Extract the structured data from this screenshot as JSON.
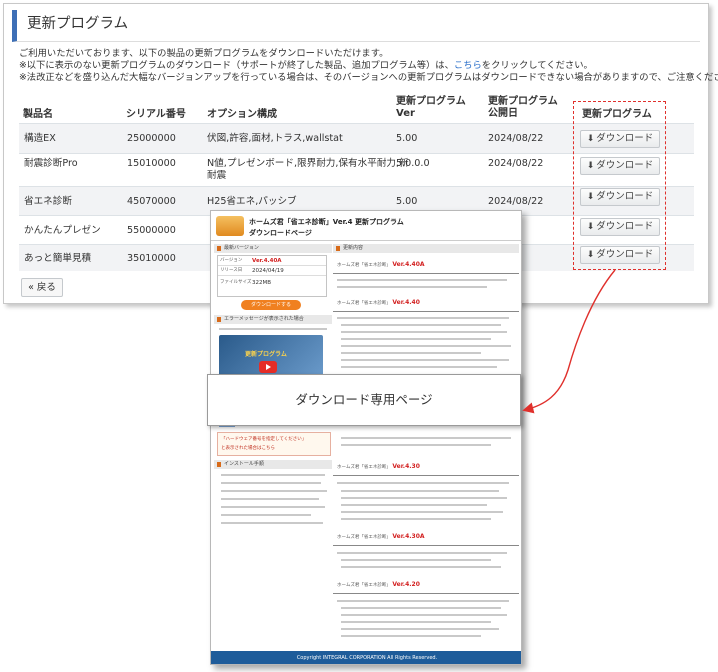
{
  "panel": {
    "title": "更新プログラム",
    "notice1": "ご利用いただいております、以下の製品の更新プログラムをダウンロードいただけます。",
    "notice2_before": "※以下に表示のない更新プログラムのダウンロード（サポートが終了した製品、追加プログラム等）は、",
    "notice2_link": "こちら",
    "notice2_after": "をクリックしてください。",
    "notice3": "※法改正などを盛り込んだ大幅なバージョンアップを行っている場合は、そのバージョンへの更新プログラムはダウンロードできない場合がありますので、ご注意ください。",
    "columns": {
      "product": "製品名",
      "serial": "シリアル番号",
      "option": "オプション構成",
      "ver_1": "更新プログラム",
      "ver_2": "Ver",
      "date_1": "更新プログラム",
      "date_2": "公開日",
      "download": "更新プログラム"
    },
    "rows": [
      {
        "product": "構造EX",
        "serial": "25000000",
        "option": "伏図,許容,面材,トラス,wallstat",
        "option2": "",
        "ver": "5.00",
        "date": "2024/08/22"
      },
      {
        "product": "耐震診断Pro",
        "serial": "15010000",
        "option": "N値,プレゼンボード,限界耐力,保有水平耐力,新",
        "option2": "耐震",
        "ver": "5.0.0.0",
        "date": "2024/08/22"
      },
      {
        "product": "省エネ診断",
        "serial": "45070000",
        "option": "H25省エネ,パッシブ",
        "option2": "",
        "ver": "5.00",
        "date": "2024/08/22"
      },
      {
        "product": "かんたんプレゼン",
        "serial": "55000000",
        "option": "",
        "option2": "",
        "ver": "",
        "date": ""
      },
      {
        "product": "あっと簡単見積",
        "serial": "35010000",
        "option": "",
        "option2": "",
        "ver": "",
        "date": ""
      }
    ],
    "download_label": "ダウンロード",
    "back_label": "« 戻る"
  },
  "overlay": {
    "title1": "ホームズ君「省エネ診断」Ver.4 更新プログラム",
    "title2": "ダウンロードページ",
    "side_head1": "最新バージョン",
    "version_rows": [
      {
        "key": "バージョン",
        "value": "Ver.4.40A"
      },
      {
        "key": "リリース日",
        "value": "2024/04/19"
      },
      {
        "key": "ファイルサイズ",
        "value": "322MB"
      }
    ],
    "dl_button": "ダウンロードする",
    "side_head2": "エラーメッセージが表示された場合",
    "video_label": "更新プログラム",
    "warn1": "「ハードウェア番号を指定してください」",
    "warn2": "と表示された場合はこちら",
    "side_head3": "インストール手順",
    "right_head": "更新内容",
    "ver_title_prefix": "ホームズ君「省エネ診断」",
    "versions": [
      "Ver.4.40A",
      "Ver.4.40",
      "Ver.4.30",
      "Ver.4.30A",
      "Ver.4.20"
    ],
    "footer": "Copyright INTEGRAL CORPORATION All Rights Reserved."
  },
  "callout": {
    "label": "ダウンロード専用ページ"
  },
  "colors": {
    "accent": "#3d6fb6",
    "highlight": "#e0302c",
    "link": "#2a6fc9",
    "orange_button": "#f08020",
    "footer": "#1e5c9a"
  }
}
